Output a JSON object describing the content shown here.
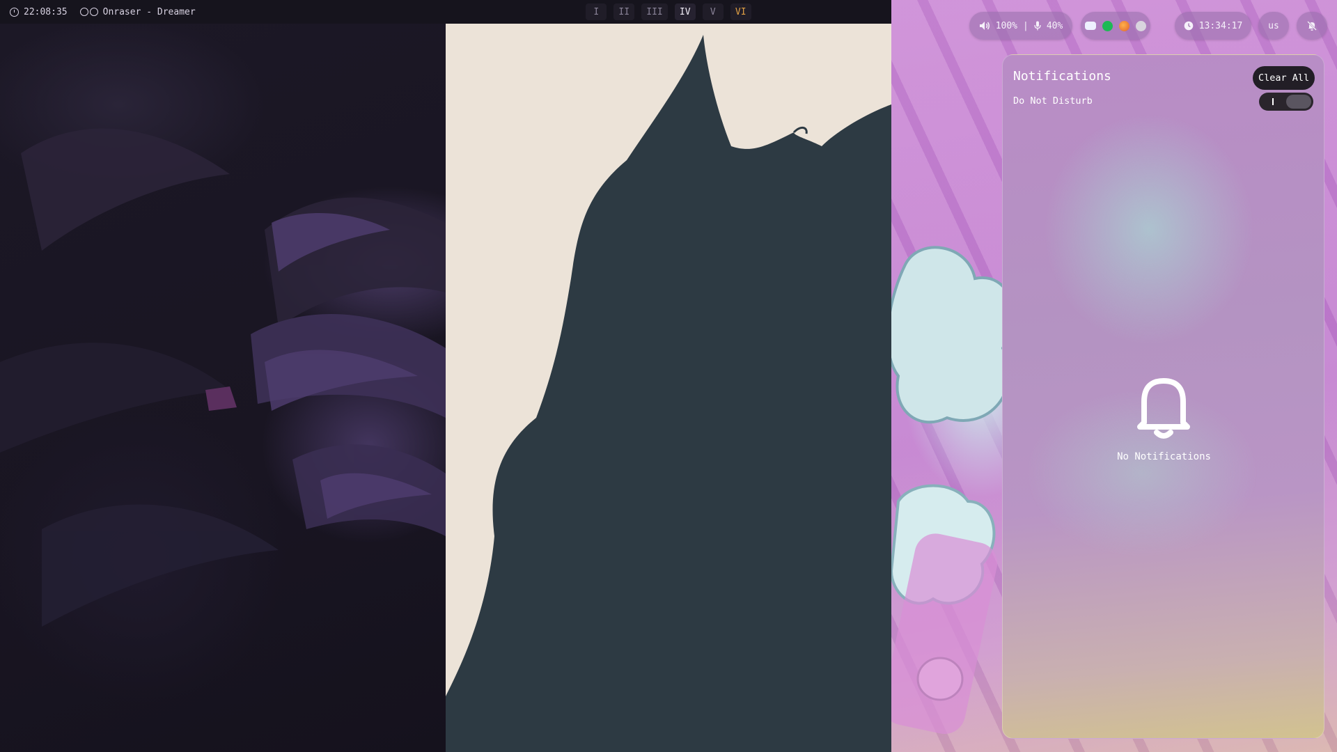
{
  "left_bar": {
    "clock": "22:08:35",
    "media_title": "Onraser - Dreamer"
  },
  "workspaces": [
    {
      "label": "I",
      "state": "normal"
    },
    {
      "label": "II",
      "state": "normal"
    },
    {
      "label": "III",
      "state": "normal"
    },
    {
      "label": "IV",
      "state": "active"
    },
    {
      "label": "V",
      "state": "normal"
    },
    {
      "label": "VI",
      "state": "urgent"
    }
  ],
  "status": {
    "volume": "100%",
    "separator": "|",
    "mic": "40%",
    "tray_icons": [
      "discord-icon",
      "spotify-icon",
      "firefox-icon",
      "steam-icon"
    ],
    "clock": "13:34:17",
    "keyboard_layout": "us"
  },
  "notifications": {
    "title": "Notifications",
    "clear_all_label": "Clear All",
    "dnd_label": "Do Not Disturb",
    "dnd_enabled": false,
    "empty_text": "No Notifications"
  },
  "colors": {
    "bar_bg": "#16141d",
    "accent_urgent": "#e0a044",
    "panel_text": "#ffffff"
  }
}
